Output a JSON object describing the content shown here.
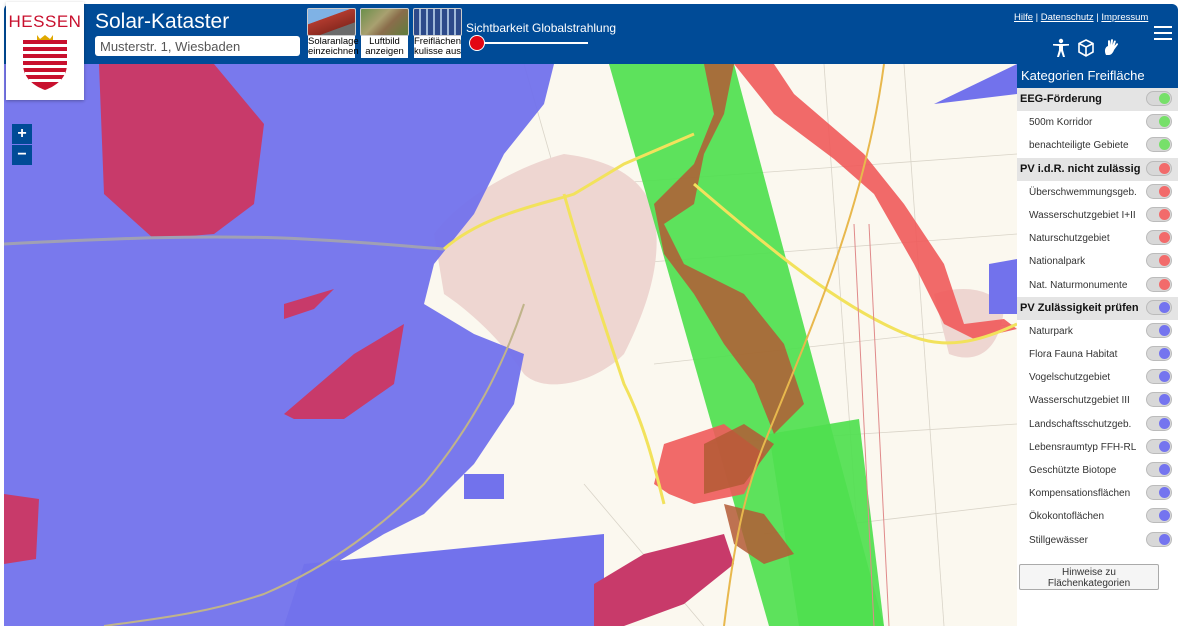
{
  "header": {
    "logo_text": "HESSEN",
    "app_title": "Solar-Kataster",
    "search_value": "Musterstr. 1, Wiesbaden",
    "tools": [
      {
        "line1": "Solaranlage",
        "line2": "einzeichnen"
      },
      {
        "line1": "Luftbild",
        "line2": "anzeigen"
      },
      {
        "line1": "Freiflächen",
        "line2": "kulisse aus"
      }
    ],
    "slider_label": "Sichtbarkeit Globalstrahlung",
    "links": {
      "help": "Hilfe",
      "privacy": "Datenschutz",
      "imprint": "Impressum",
      "separator": " | "
    },
    "colors": {
      "brand": "#004b97",
      "accent_red": "#e30613"
    }
  },
  "map": {
    "zoom_in": "+",
    "zoom_out": "−"
  },
  "panel": {
    "title": "Kategorien Freifläche",
    "rows": [
      {
        "label": "EEG-Förderung",
        "section": true,
        "color": "#77e06a"
      },
      {
        "label": "500m Korridor",
        "section": false,
        "color": "#77e06a"
      },
      {
        "label": "benachteiligte Gebiete",
        "section": false,
        "color": "#77e06a"
      },
      {
        "label": "PV i.d.R. nicht zulässig",
        "section": true,
        "color": "#f26b6b"
      },
      {
        "label": "Überschwemmungsgeb.",
        "section": false,
        "color": "#f26b6b"
      },
      {
        "label": "Wasserschutzgebiet I+II",
        "section": false,
        "color": "#f26b6b"
      },
      {
        "label": "Naturschutzgebiet",
        "section": false,
        "color": "#f26b6b"
      },
      {
        "label": "Nationalpark",
        "section": false,
        "color": "#f26b6b"
      },
      {
        "label": "Nat. Naturmonumente",
        "section": false,
        "color": "#f26b6b"
      },
      {
        "label": "PV Zulässigkeit prüfen",
        "section": true,
        "color": "#7474ef"
      },
      {
        "label": "Naturpark",
        "section": false,
        "color": "#7474ef"
      },
      {
        "label": "Flora Fauna Habitat",
        "section": false,
        "color": "#7474ef"
      },
      {
        "label": "Vogelschutzgebiet",
        "section": false,
        "color": "#7474ef"
      },
      {
        "label": "Wasserschutzgebiet III",
        "section": false,
        "color": "#7474ef"
      },
      {
        "label": "Landschaftsschutzgeb.",
        "section": false,
        "color": "#7474ef"
      },
      {
        "label": "Lebensraumtyp FFH-RL",
        "section": false,
        "color": "#7474ef"
      },
      {
        "label": "Geschützte Biotope",
        "section": false,
        "color": "#7474ef"
      },
      {
        "label": "Kompensationsflächen",
        "section": false,
        "color": "#7474ef"
      },
      {
        "label": "Ökokontoflächen",
        "section": false,
        "color": "#7474ef"
      },
      {
        "label": "Stillgewässer",
        "section": false,
        "color": "#7474ef"
      }
    ],
    "hint_button": {
      "line1": "Hinweise zu",
      "line2": "Flächenkategorien"
    }
  }
}
